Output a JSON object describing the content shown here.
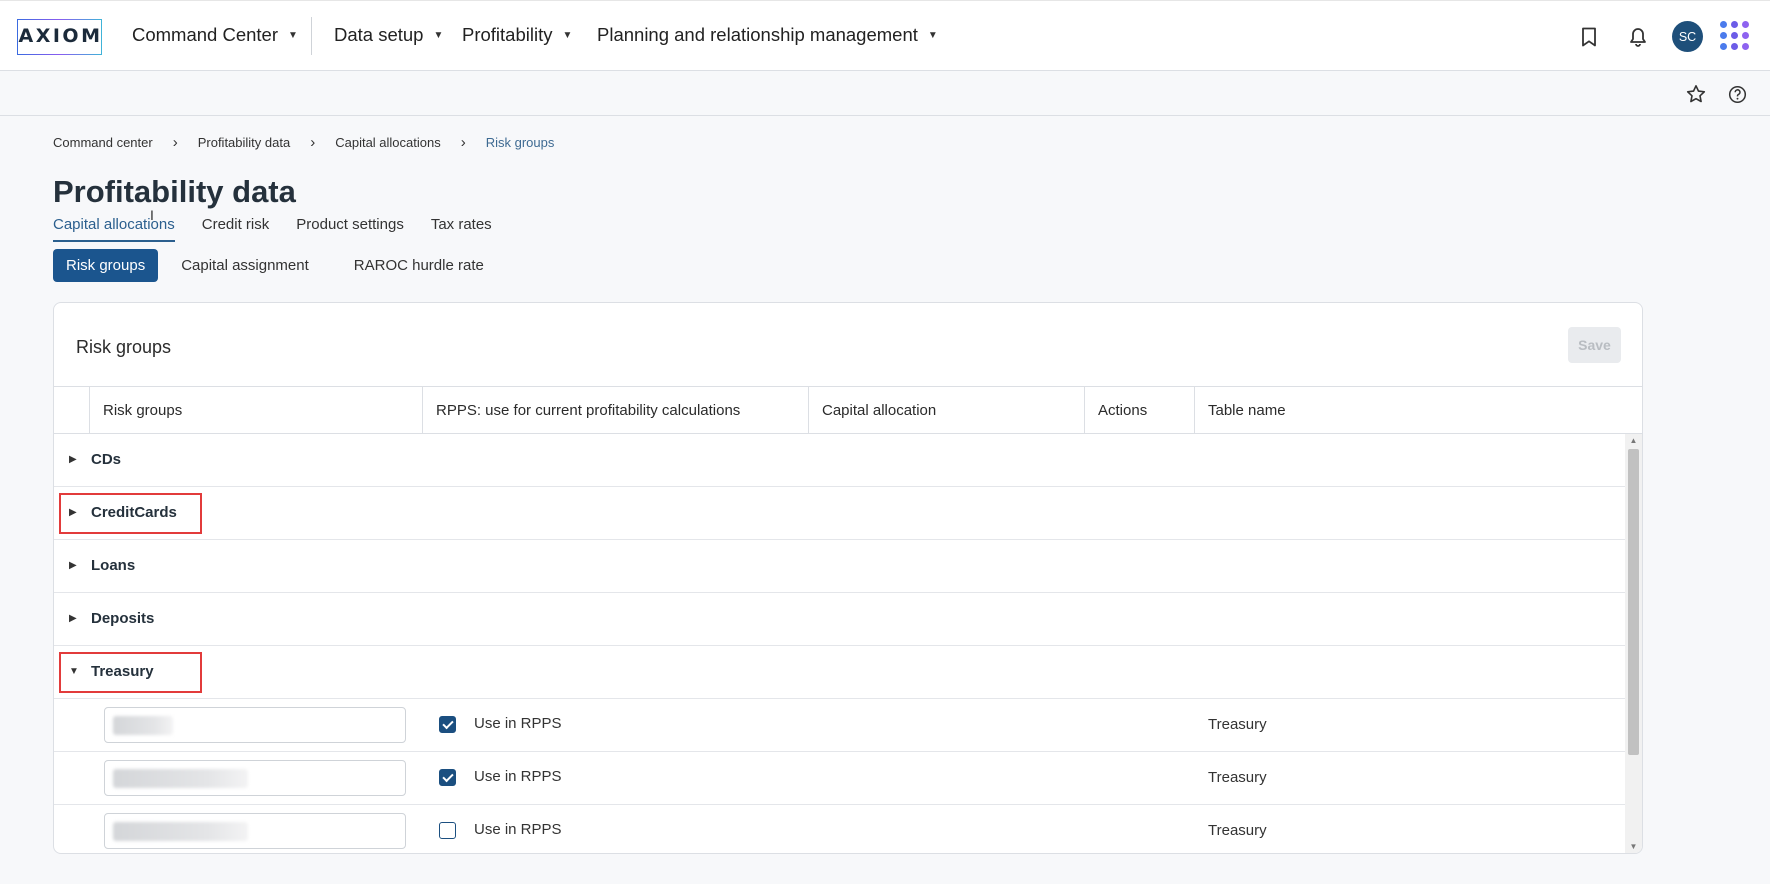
{
  "app": {
    "logo_text": "AXIOM",
    "nav": [
      {
        "label": "Command Center"
      },
      {
        "label": "Data setup"
      },
      {
        "label": "Profitability"
      },
      {
        "label": "Planning and relationship management"
      }
    ],
    "avatar_initials": "SC",
    "icons": {
      "bookmark": "bookmark-icon",
      "bell": "bell-icon",
      "apps": "apps-grid-icon",
      "star": "star-icon",
      "help": "help-icon"
    },
    "brand_color": "#1b558e"
  },
  "breadcrumb": [
    "Command center",
    "Profitability data",
    "Capital allocations",
    "Risk groups"
  ],
  "page_title": "Profitability data",
  "tabs": [
    {
      "label": "Capital allocations",
      "active": true
    },
    {
      "label": "Credit risk"
    },
    {
      "label": "Product settings"
    },
    {
      "label": "Tax rates"
    }
  ],
  "subtabs": [
    {
      "label": "Risk groups",
      "active": true
    },
    {
      "label": "Capital assignment"
    },
    {
      "label": "RAROC hurdle rate"
    }
  ],
  "card": {
    "title": "Risk groups",
    "save_label": "Save",
    "columns": [
      "Risk groups",
      "RPPS: use for current profitability calculations",
      "Capital allocation",
      "Actions",
      "Table name"
    ],
    "groups": [
      {
        "name": "CDs",
        "expanded": false
      },
      {
        "name": "CreditCards",
        "expanded": false,
        "highlighted": true
      },
      {
        "name": "Loans",
        "expanded": false
      },
      {
        "name": "Deposits",
        "expanded": false
      },
      {
        "name": "Treasury",
        "expanded": true,
        "highlighted": true
      }
    ],
    "treasury_items": [
      {
        "rpps_label": "Use in RPPS",
        "checked": true,
        "table_name": "Treasury"
      },
      {
        "rpps_label": "Use in RPPS",
        "checked": true,
        "table_name": "Treasury"
      },
      {
        "rpps_label": "Use in RPPS",
        "checked": false,
        "table_name": "Treasury"
      }
    ]
  }
}
